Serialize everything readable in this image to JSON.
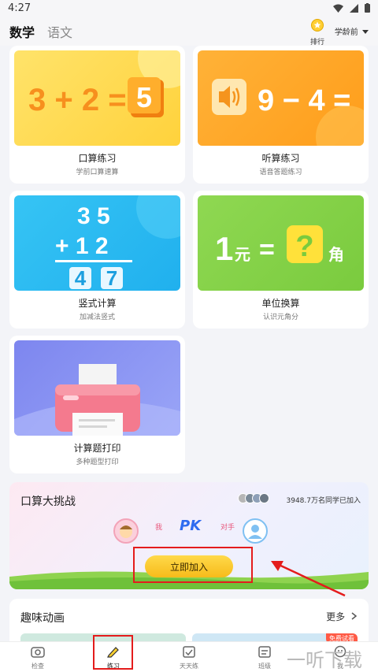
{
  "status": {
    "time": "4:27"
  },
  "tabs": {
    "math": "数学",
    "chinese": "语文"
  },
  "header": {
    "rank_label": "排行榜",
    "age_label": "学龄前"
  },
  "cards": [
    {
      "title": "口算练习",
      "subtitle": "学前口算速算",
      "art": "3 + 2 = 5"
    },
    {
      "title": "听算练习",
      "subtitle": "语音答题练习",
      "art": "9 − 4 ="
    },
    {
      "title": "竖式计算",
      "subtitle": "加减法竖式",
      "art_top": "3  5",
      "art_mid": "+ 1  2",
      "art_ans1": "4",
      "art_ans2": "7"
    },
    {
      "title": "单位换算",
      "subtitle": "认识元角分",
      "art_yuan_num": "1",
      "art_yuan": "元",
      "art_eq": "=",
      "art_q": "?",
      "art_jiao": "角"
    },
    {
      "title": "计算题打印",
      "subtitle": "多种题型打印"
    }
  ],
  "challenge": {
    "title": "口算大挑战",
    "joined": "3948.7万名同学已加入",
    "me_label": "我",
    "pk": "PK",
    "opponent_label": "对手",
    "join_button": "立即加入"
  },
  "animations": {
    "title": "趣味动画",
    "more": "更多",
    "badge": "免费试看"
  },
  "nav": [
    "检查",
    "练习",
    "天天练",
    "班级",
    "我"
  ],
  "watermark": "一听下载",
  "colors": {
    "accent": "#f6bb1a",
    "pk_blue": "#2f6cf0",
    "annotation_red": "#e41c1c"
  }
}
